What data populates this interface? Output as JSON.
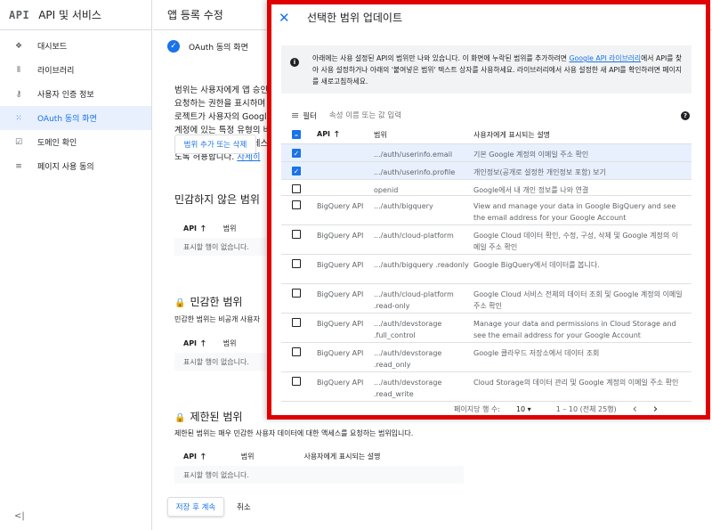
{
  "sidebar": {
    "logo": "API",
    "title": "API 및 서비스",
    "items": [
      {
        "label": "대시보드",
        "icon": "dashboard-icon",
        "glyph": "❖"
      },
      {
        "label": "라이브러리",
        "icon": "library-icon",
        "glyph": "⦀"
      },
      {
        "label": "사용자 인증 정보",
        "icon": "key-icon",
        "glyph": "⚷"
      },
      {
        "label": "OAuth 동의 화면",
        "icon": "consent-screen-icon",
        "glyph": "⁙"
      },
      {
        "label": "도메인 확인",
        "icon": "domain-verification-icon",
        "glyph": "☑"
      },
      {
        "label": "페이지 사용 동의",
        "icon": "page-usage-icon",
        "glyph": "≡"
      }
    ],
    "collapse_glyph": "<|"
  },
  "main": {
    "header_title": "앱 등록 수정",
    "step_label": "OAuth 동의 화면",
    "intro_text": "범위는 사용자에게 앱 승인을 요청하는 권한을 표시하며 프로젝트가 사용자의 Google 계정에 있는 특정 유형의 비공개 사용자 데이터에 액세스하도록 허용합니다.",
    "intro_link": "자세히",
    "add_scope_button": "범위 추가 또는 삭제",
    "nonsensitive": {
      "title": "민감하지 않은 범위",
      "col_api": "API",
      "col_scope": "범위",
      "empty": "표시할 행이 없습니다."
    },
    "sensitive": {
      "title": "민감한 범위",
      "desc": "민감한 범위는 비공개 사용자",
      "col_api": "API",
      "col_scope": "범위",
      "empty": "표시할 행이 없습니다."
    },
    "restricted": {
      "title": "제한된 범위",
      "desc": "제한된 범위는 매우 민감한 사용자 데이터에 대한 액세스를 요청하는 범위입니다.",
      "col_api": "API",
      "col_scope": "범위",
      "col_desc": "사용자에게 표시되는 설명",
      "empty": "표시할 행이 없습니다."
    },
    "save_button": "저장 후 계속",
    "cancel_button": "취소"
  },
  "panel": {
    "title": "선택한 범위 업데이트",
    "info_text_1": "아래에는 사용 설정된 API의 범위만 나와 있습니다. 이 화면에 누락된 범위를 추가하려면 ",
    "info_link": "Google API 라이브러리",
    "info_text_2": "에서 API를 찾아 사용 설정하거나 아래의 '붙여넣은 범위' 텍스트 상자를 사용하세요. 라이브러리에서 사용 설정한 새 API를 확인하려면 페이지를 새로고침하세요.",
    "filter_label": "필터",
    "filter_placeholder": "속성 이름 또는 값 입력",
    "columns": {
      "api": "API",
      "scope": "범위",
      "desc": "사용자에게 표시되는 설명"
    },
    "rows": [
      {
        "checked": true,
        "api": "",
        "scope": ".../auth/userinfo.email",
        "desc": "기본 Google 계정의 이메일 주소 확인"
      },
      {
        "checked": true,
        "api": "",
        "scope": ".../auth/userinfo.profile",
        "desc": "개인정보(공개로 설정한 개인정보 포함) 보기"
      },
      {
        "checked": false,
        "api": "",
        "scope": "openid",
        "desc": "Google에서 내 개인 정보를 나와 연결"
      },
      {
        "checked": false,
        "api": "BigQuery API",
        "scope": ".../auth/bigquery",
        "desc": "View and manage your data in Google BigQuery and see the email address for your Google Account"
      },
      {
        "checked": false,
        "api": "BigQuery API",
        "scope": ".../auth/cloud-platform",
        "desc": "Google Cloud 데이터 확인, 수정, 구성, 삭제 및 Google 계정의 이메일 주소 확인"
      },
      {
        "checked": false,
        "api": "BigQuery API",
        "scope": ".../auth/bigquery .readonly",
        "desc": "Google BigQuery에서 데이터를 봅니다."
      },
      {
        "checked": false,
        "api": "BigQuery API",
        "scope": ".../auth/cloud-platform .read-only",
        "desc": "Google Cloud 서비스 전체의 데이터 조회 및 Google 계정의 이메일 주소 확인"
      },
      {
        "checked": false,
        "api": "BigQuery API",
        "scope": ".../auth/devstorage .full_control",
        "desc": "Manage your data and permissions in Cloud Storage and see the email address for your Google Account"
      },
      {
        "checked": false,
        "api": "BigQuery API",
        "scope": ".../auth/devstorage .read_only",
        "desc": "Google 클라우드 저장소에서 데이터 조회"
      },
      {
        "checked": false,
        "api": "BigQuery API",
        "scope": ".../auth/devstorage .read_write",
        "desc": "Cloud Storage의 데이터 관리 및 Google 계정의 이메일 주소 확인"
      }
    ],
    "pager": {
      "rows_per_page_label": "페이지당 행 수:",
      "rows_per_page": "10 ▾",
      "range": "1 – 10 (전체 25행)",
      "prev": "‹",
      "next": "›"
    }
  },
  "colors": {
    "accent": "#1a73e8",
    "highlight_border": "#e00000",
    "selected_row": "#e8f0fe"
  }
}
